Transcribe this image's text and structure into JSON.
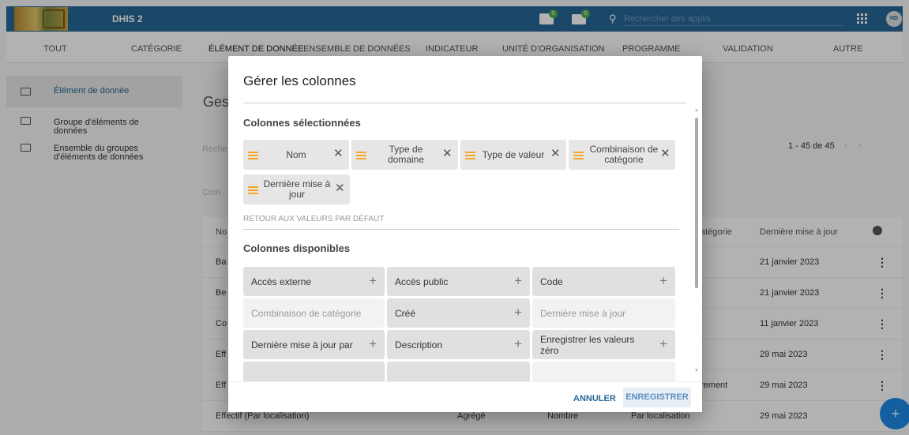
{
  "app": {
    "name": "DHIS 2",
    "user_initials": "HD",
    "search_placeholder": "Rechercher des applis",
    "notif_messages": "0",
    "notif_mail": "0"
  },
  "tabs": [
    "Tout",
    "Catégorie",
    "Élément de donnée",
    "Ensemble de données",
    "Indicateur",
    "Unité d'organisation",
    "Programme",
    "Validation",
    "Autre"
  ],
  "sidebar": {
    "items": [
      {
        "label": "Élément de donnée"
      },
      {
        "label": "Groupe d'éléments de données"
      },
      {
        "label": "Ensemble du groupes d'éléments de données"
      }
    ]
  },
  "background": {
    "title": "Ges",
    "search_placeholder": "Reche",
    "comp": "Com",
    "pager": "1 - 45 de 45",
    "table": {
      "headers": [
        "No",
        "atégorie",
        "Dernière mise à jour"
      ],
      "rows": [
        {
          "name": "Ba",
          "mid": "",
          "col": "",
          "cat": "",
          "date": "21 janvier 2023"
        },
        {
          "name": "Be",
          "mid": "",
          "col": "",
          "cat": "",
          "date": "21 janvier 2023"
        },
        {
          "name": "Co",
          "mid": "",
          "col": "",
          "cat": "",
          "date": "11 janvier 2023"
        },
        {
          "name": "Eff",
          "mid": "",
          "col": "",
          "cat": "",
          "date": "29 mai 2023"
        },
        {
          "name": "Eff",
          "mid": "",
          "col": "",
          "cat": "rement",
          "date": "29 mai 2023"
        },
        {
          "name": "Effectif (Par localisation)",
          "mid": "Agrégé",
          "col": "Nombre",
          "cat": "Par localisation",
          "date": "29 mai 2023"
        }
      ]
    }
  },
  "dialog": {
    "title": "Gérer les colonnes",
    "selected_title": "Colonnes sélectionnées",
    "selected": [
      {
        "label": "Nom"
      },
      {
        "label": "Type de domaine"
      },
      {
        "label": "Type de valeur"
      },
      {
        "label": "Combinaison de catégorie"
      },
      {
        "label": "Dernière mise à jour"
      }
    ],
    "reset_label": "Retour aux valeurs par défaut",
    "available_title": "Colonnes disponibles",
    "available": [
      {
        "label": "Accès externe"
      },
      {
        "label": "Accès public"
      },
      {
        "label": "Code"
      },
      {
        "label": "Combinaison de catégorie"
      },
      {
        "label": "Créé"
      },
      {
        "label": "Dernière mise à jour"
      },
      {
        "label": "Dernière mise à jour par"
      },
      {
        "label": "Description"
      },
      {
        "label": "Enregistrer les valeurs zéro"
      }
    ],
    "cancel_label": "Annuler",
    "save_label": "Enregistrer"
  },
  "colors": {
    "header": "#276696",
    "handle": "#f5a623",
    "fab": "#1e88e5"
  }
}
